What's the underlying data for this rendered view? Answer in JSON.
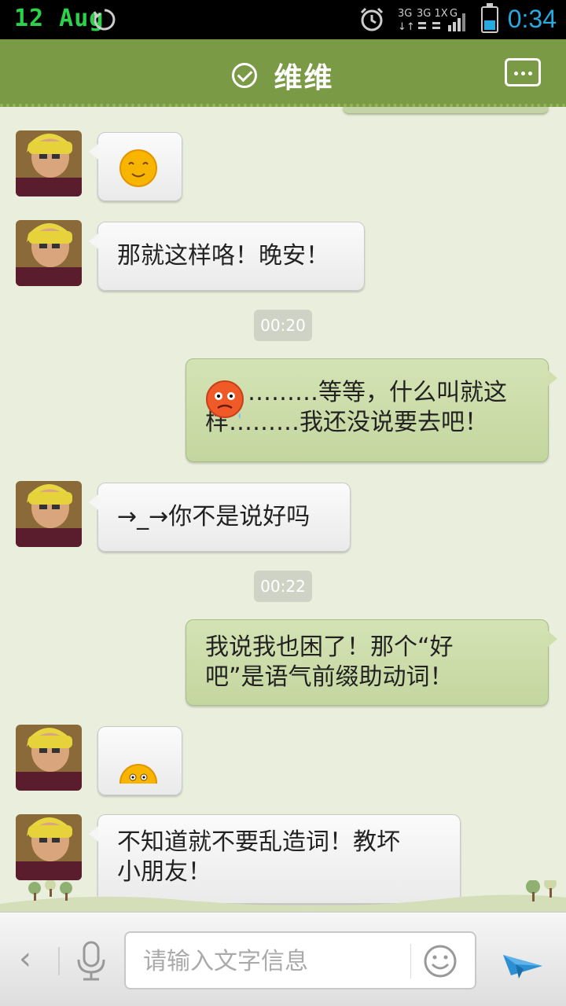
{
  "status_bar": {
    "date": "12 Aug",
    "time": "0:34",
    "network": {
      "line1": "3G 3G 1X G",
      "line2": "↓↑ ⇅ ⇅"
    }
  },
  "header": {
    "title": "维维",
    "online_icon": "check-circle-icon",
    "more_icon": "chat-more-icon"
  },
  "messages": [
    {
      "side": "in",
      "emoji": "smile-emoji"
    },
    {
      "side": "in",
      "text": "那就这样咯！晚安！"
    },
    {
      "side": "time",
      "text": "00:20"
    },
    {
      "side": "out",
      "emoji": "angry-emoji",
      "text": "………等等，什么叫就这样………我还没说要去吧！"
    },
    {
      "side": "in",
      "text": "→_→你不是说好吗"
    },
    {
      "side": "time",
      "text": "00:22"
    },
    {
      "side": "out",
      "text": "我说我也困了！那个“好吧”是语气前缀助动词！"
    },
    {
      "side": "in",
      "emoji": "peek-emoji"
    },
    {
      "side": "in",
      "text": "不知道就不要乱造词！教坏小朋友！"
    }
  ],
  "input_bar": {
    "placeholder": "请输入文字信息",
    "back_icon": "chevron-left-icon",
    "mic_icon": "microphone-icon",
    "emoji_icon": "smiley-icon",
    "send_icon": "send-plane-icon"
  },
  "colors": {
    "header_green": "#7a9a45",
    "outgoing_bubble": "#c8d9a6",
    "background": "#e9eedd",
    "time_accent": "#27a9e1"
  }
}
